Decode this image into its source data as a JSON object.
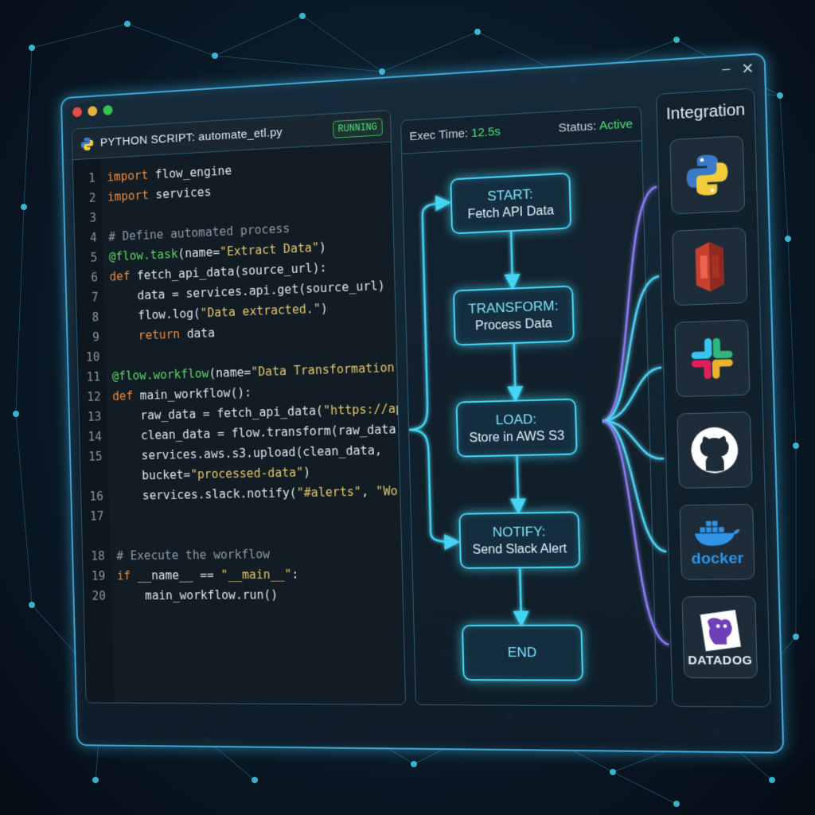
{
  "window": {
    "controls": {
      "minimize": "–",
      "close": "✕"
    }
  },
  "code_panel": {
    "title": "PYTHON SCRIPT: automate_etl.py",
    "status_badge": "RUNNING",
    "lines": [
      {
        "n": "1",
        "text": "import flow_engine"
      },
      {
        "n": "2",
        "text": "import services"
      },
      {
        "n": "3",
        "text": ""
      },
      {
        "n": "4",
        "text": "# Define automated process"
      },
      {
        "n": "5",
        "text": "@flow.task(name=\"Extract Data\")"
      },
      {
        "n": "6",
        "text": "def fetch_api_data(source_url):"
      },
      {
        "n": "7",
        "text": "    data = services.api.get(source_url)"
      },
      {
        "n": "8",
        "text": "    flow.log(\"Data extracted.\")"
      },
      {
        "n": "9",
        "text": "    return data"
      },
      {
        "n": "10",
        "text": ""
      },
      {
        "n": "11",
        "text": "@flow.workflow(name=\"Data Transformation\")"
      },
      {
        "n": "12",
        "text": "def main_workflow():"
      },
      {
        "n": "13",
        "text": "    raw_data = fetch_api_data(\"https://api.s"
      },
      {
        "n": "14",
        "text": "    clean_data = flow.transform(raw_data, ty"
      },
      {
        "n": "15",
        "text": "    services.aws.s3.upload(clean_data,"
      },
      {
        "n": "",
        "text": "    bucket=\"processed-data\")"
      },
      {
        "n": "16",
        "text": "    services.slack.notify(\"#alerts\", \"Workfl"
      },
      {
        "n": "17",
        "text": ""
      },
      {
        "n": "",
        "text": ""
      },
      {
        "n": "18",
        "text": "# Execute the workflow"
      },
      {
        "n": "19",
        "text": "if __name__ == \"__main__\":"
      },
      {
        "n": "20",
        "text": "    main_workflow.run()"
      }
    ]
  },
  "flow_panel": {
    "exec_label": "Exec Time:",
    "exec_value": "12.5s",
    "status_label": "Status:",
    "status_value": "Active",
    "nodes": [
      {
        "title": "START:",
        "sub": "Fetch API Data"
      },
      {
        "title": "TRANSFORM:",
        "sub": "Process Data"
      },
      {
        "title": "LOAD:",
        "sub": "Store in AWS S3"
      },
      {
        "title": "NOTIFY:",
        "sub": "Send Slack Alert"
      },
      {
        "title": "END",
        "sub": ""
      }
    ]
  },
  "integrations": {
    "title": "Integration",
    "items": [
      {
        "icon": "python-icon",
        "label": ""
      },
      {
        "icon": "aws-s3-icon",
        "label": ""
      },
      {
        "icon": "slack-icon",
        "label": ""
      },
      {
        "icon": "github-icon",
        "label": ""
      },
      {
        "icon": "docker-icon",
        "label": "docker"
      },
      {
        "icon": "datadog-icon",
        "label": "DATADOG"
      }
    ]
  },
  "colors": {
    "accent_cyan": "#45d4f4",
    "running_green": "#4fe07a",
    "keyword_orange": "#f08a3a",
    "string_yellow": "#e5c76b"
  }
}
